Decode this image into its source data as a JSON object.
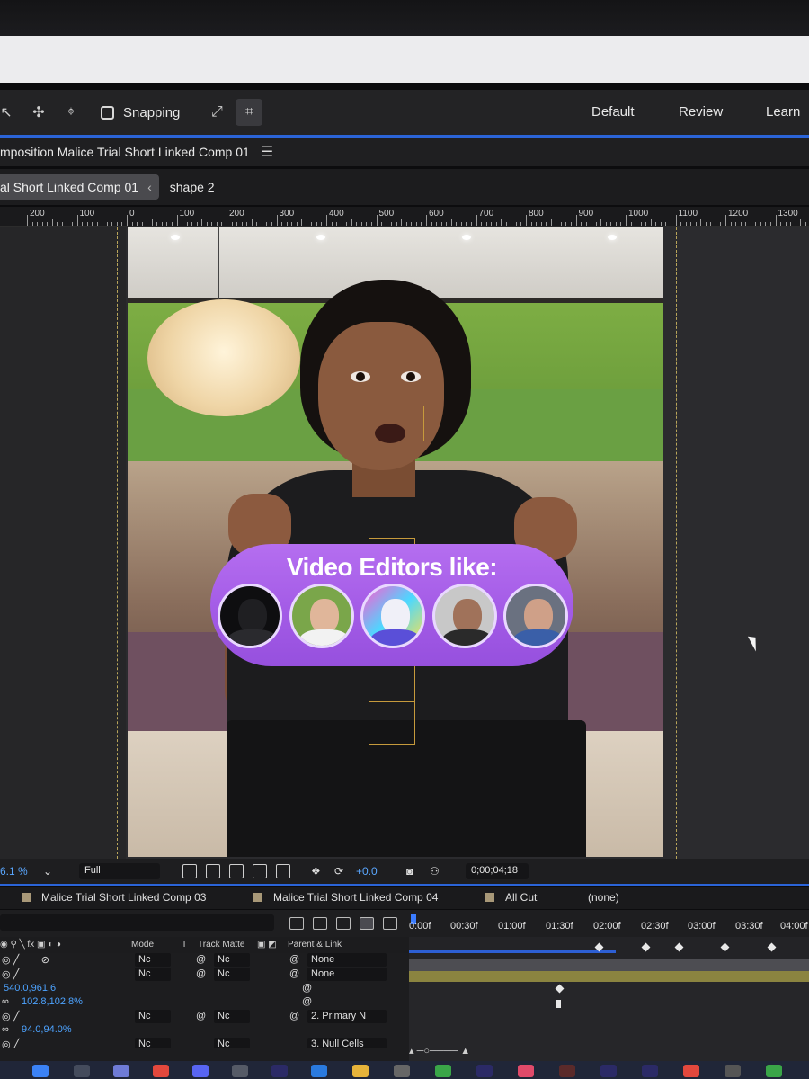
{
  "toolbar": {
    "snapping_label": "Snapping",
    "workspaces": [
      "Default",
      "Review",
      "Learn"
    ]
  },
  "composition_panel": {
    "title": "mposition Malice Trial Short Linked Comp 01",
    "menu_icon": "hamburger-icon"
  },
  "viewer_tabs": {
    "active_tab": "al Short Linked Comp 01",
    "secondary_tab": "shape 2"
  },
  "ruler": {
    "labels": [
      "200",
      "100",
      "0",
      "100",
      "200",
      "300",
      "400",
      "500",
      "600",
      "700",
      "800",
      "900",
      "1000",
      "1100",
      "1200",
      "1300"
    ]
  },
  "video_overlay": {
    "title": "Video Editors like:",
    "avatar_count": 5
  },
  "viewer_footer": {
    "zoom": "6.1 %",
    "resolution": "Full",
    "exposure": "+0.0",
    "timecode": "0;00;04;18"
  },
  "timeline_tabs": [
    "Malice Trial Short Linked Comp 03",
    "Malice Trial Short Linked Comp 04",
    "All Cut",
    "(none)"
  ],
  "time_ruler": [
    "0:00f",
    "00:30f",
    "01:00f",
    "01:30f",
    "02:00f",
    "02:30f",
    "03:00f",
    "03:30f",
    "04:00f"
  ],
  "columns": {
    "mode": "Mode",
    "t": "T",
    "track_matte": "Track Matte",
    "parent": "Parent & Link"
  },
  "layers": {
    "row1_mode": "Nc",
    "row1_matte": "Nc",
    "row1_parent": "None",
    "row2_mode": "Nc",
    "row2_matte": "Nc",
    "row2_parent": "None",
    "position_value": "540.0,961.6",
    "scale_value": "102.8,102.8%",
    "row3_mode": "Nc",
    "row3_matte": "Nc",
    "row3_parent": "2. Primary N",
    "scale2_value": "94.0,94.0%",
    "row4_mode": "Nc",
    "row4_matte": "Nc",
    "row4_parent": "3. Null Cells"
  },
  "colors": {
    "accent_blue": "#2b64d8",
    "pill_purple": "#a35be6",
    "panel_bg": "#232325"
  }
}
